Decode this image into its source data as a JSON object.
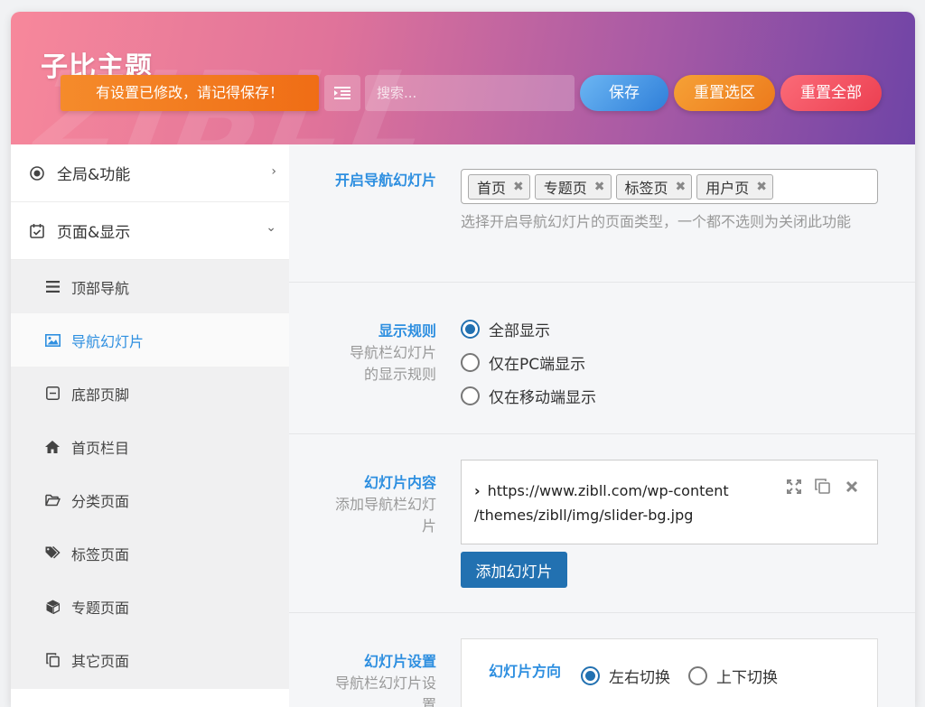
{
  "header": {
    "brand": "子比主题",
    "watermark": "ZIBLL",
    "notice": "有设置已修改，请记得保存！",
    "search_placeholder": "搜索...",
    "save_label": "保存",
    "reset_section_label": "重置选区",
    "reset_all_label": "重置全部"
  },
  "sidebar": {
    "groups": [
      {
        "label": "全局&功能",
        "icon": "target-icon"
      },
      {
        "label": "页面&显示",
        "icon": "calendar-check-icon"
      }
    ],
    "items": [
      {
        "label": "顶部导航",
        "icon": "bars-icon"
      },
      {
        "label": "导航幻灯片",
        "icon": "image-icon"
      },
      {
        "label": "底部页脚",
        "icon": "minus-square-icon"
      },
      {
        "label": "首页栏目",
        "icon": "home-icon"
      },
      {
        "label": "分类页面",
        "icon": "folder-icon"
      },
      {
        "label": "标签页面",
        "icon": "tags-icon"
      },
      {
        "label": "专题页面",
        "icon": "cube-icon"
      },
      {
        "label": "其它页面",
        "icon": "copy-icon"
      }
    ]
  },
  "main": {
    "slider_pages": {
      "title": "开启导航幻灯片",
      "tags": [
        "首页",
        "专题页",
        "标签页",
        "用户页"
      ],
      "help": "选择开启导航幻灯片的页面类型，一个都不选则为关闭此功能"
    },
    "display_rule": {
      "title": "显示规则",
      "desc": "导航栏幻灯片的显示规则",
      "options": [
        "全部显示",
        "仅在PC端显示",
        "仅在移动端显示"
      ],
      "selected": "全部显示"
    },
    "slider_content": {
      "title": "幻灯片内容",
      "desc": "添加导航栏幻灯片",
      "item_url": "https://www.zibll.com/wp-content/themes/zibll/img/slider-bg.jpg",
      "item_url_line1": "https://www.zibll.com/wp-content",
      "item_url_line2": "/themes/zibll/img/slider-bg.jpg",
      "add_label": "添加幻灯片"
    },
    "slider_settings": {
      "title": "幻灯片设置",
      "desc": "导航栏幻灯片设置",
      "direction_label": "幻灯片方向",
      "direction_options": [
        "左右切换",
        "上下切换"
      ],
      "direction_selected": "左右切换"
    }
  }
}
